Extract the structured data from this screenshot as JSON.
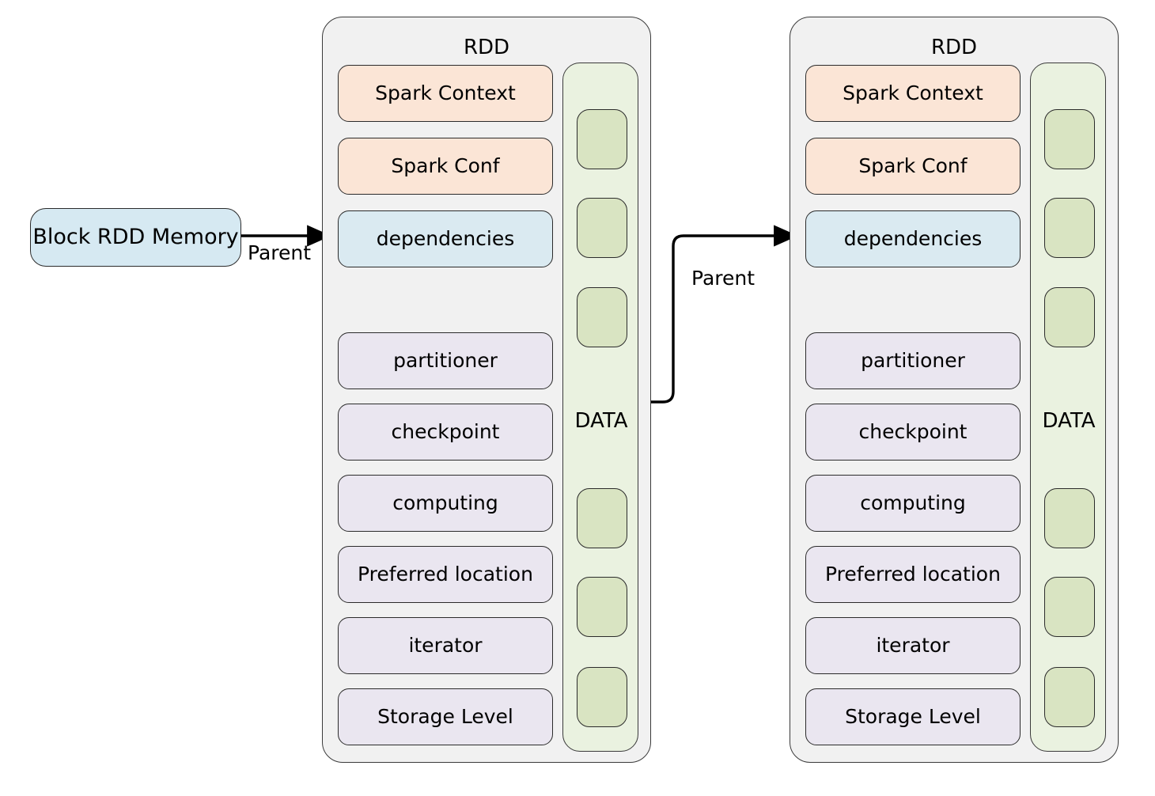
{
  "diagram": {
    "title_text": "RDD",
    "background": "#ffffff"
  },
  "colors": {
    "panel_fill": "#f1f1f1",
    "panel_stroke": "#3a3a3a",
    "peach": "#fbe5d6",
    "blue": "#daeaf1",
    "purple": "#eae6f0",
    "data_column": "#eaf2e0",
    "data_cell": "#d9e4c2",
    "memory_box": "#d6e9f2",
    "edge_stroke": "#000000"
  },
  "memory_node": {
    "label": "Block RDD Memory"
  },
  "edges": [
    {
      "label": "Parent",
      "from": "block-rdd-memory",
      "to": "rdd-1-dependencies"
    },
    {
      "label": "Parent",
      "from": "rdd-1-data",
      "to": "rdd-2-dependencies"
    }
  ],
  "rdds": [
    {
      "id": "rdd-1",
      "title": "RDD",
      "attributes": [
        {
          "label": "Spark Context",
          "style": "peach"
        },
        {
          "label": "Spark Conf",
          "style": "peach"
        },
        {
          "label": "dependencies",
          "style": "blue"
        },
        {
          "label": "partitioner",
          "style": "purple"
        },
        {
          "label": "checkpoint",
          "style": "purple"
        },
        {
          "label": "computing",
          "style": "purple"
        },
        {
          "label": "Preferred location",
          "style": "purple"
        },
        {
          "label": "iterator",
          "style": "purple"
        },
        {
          "label": "Storage Level",
          "style": "purple"
        }
      ],
      "data_column": {
        "label": "DATA",
        "cell_count": 6
      }
    },
    {
      "id": "rdd-2",
      "title": "RDD",
      "attributes": [
        {
          "label": "Spark Context",
          "style": "peach"
        },
        {
          "label": "Spark Conf",
          "style": "peach"
        },
        {
          "label": "dependencies",
          "style": "blue"
        },
        {
          "label": "partitioner",
          "style": "purple"
        },
        {
          "label": "checkpoint",
          "style": "purple"
        },
        {
          "label": "computing",
          "style": "purple"
        },
        {
          "label": "Preferred location",
          "style": "purple"
        },
        {
          "label": "iterator",
          "style": "purple"
        },
        {
          "label": "Storage Level",
          "style": "purple"
        }
      ],
      "data_column": {
        "label": "DATA",
        "cell_count": 6
      }
    }
  ]
}
